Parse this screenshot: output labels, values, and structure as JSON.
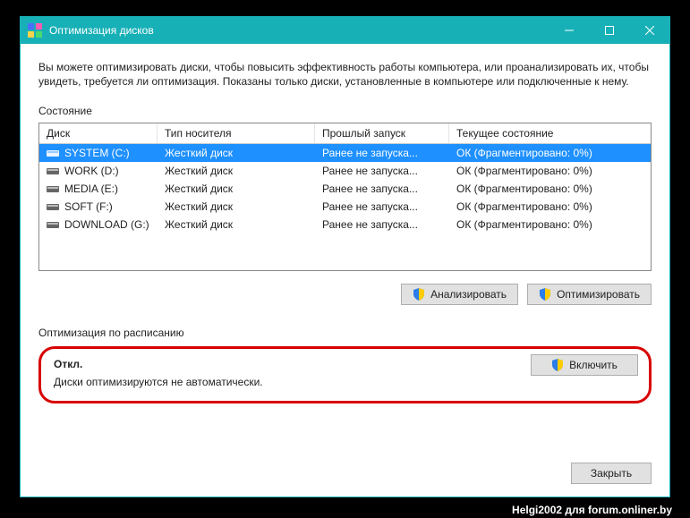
{
  "window": {
    "title": "Оптимизация дисков"
  },
  "intro": "Вы можете оптимизировать диски, чтобы повысить эффективность работы  компьютера, или проанализировать их, чтобы увидеть, требуется ли оптимизация. Показаны только диски, установленные в компьютере или подключенные к нему.",
  "status_label": "Состояние",
  "columns": {
    "disk": "Диск",
    "media": "Тип носителя",
    "last_run": "Прошлый запуск",
    "current": "Текущее состояние"
  },
  "rows": [
    {
      "name": "SYSTEM (C:)",
      "media": "Жесткий диск",
      "last": "Ранее не запуска...",
      "state": "ОК (Фрагментировано: 0%)",
      "selected": true
    },
    {
      "name": "WORK (D:)",
      "media": "Жесткий диск",
      "last": "Ранее не запуска...",
      "state": "ОК (Фрагментировано: 0%)",
      "selected": false
    },
    {
      "name": "MEDIA (E:)",
      "media": "Жесткий диск",
      "last": "Ранее не запуска...",
      "state": "ОК (Фрагментировано: 0%)",
      "selected": false
    },
    {
      "name": "SOFT (F:)",
      "media": "Жесткий диск",
      "last": "Ранее не запуска...",
      "state": "ОК (Фрагментировано: 0%)",
      "selected": false
    },
    {
      "name": "DOWNLOAD (G:)",
      "media": "Жесткий диск",
      "last": "Ранее не запуска...",
      "state": "ОК (Фрагментировано: 0%)",
      "selected": false
    }
  ],
  "buttons": {
    "analyze": "Анализировать",
    "optimize": "Оптимизировать",
    "enable": "Включить",
    "close": "Закрыть"
  },
  "schedule": {
    "label": "Оптимизация по расписанию",
    "status": "Откл.",
    "desc": "Диски оптимизируются не автоматически."
  },
  "watermark": "Helgi2002 для forum.onliner.by"
}
